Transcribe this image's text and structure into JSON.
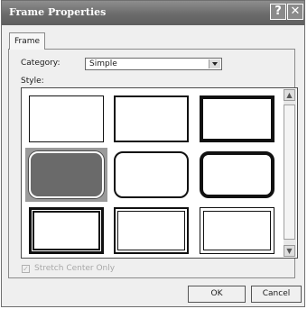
{
  "window": {
    "title": "Frame Properties",
    "help_glyph": "?",
    "close_glyph": "✕"
  },
  "tabs": [
    {
      "label": "Frame",
      "active": true
    }
  ],
  "category": {
    "label": "Category:",
    "value": "Simple"
  },
  "style": {
    "label": "Style:",
    "selected_index": 3,
    "items": [
      {
        "name": "thin-border-frame"
      },
      {
        "name": "medium-border-frame"
      },
      {
        "name": "thick-border-frame"
      },
      {
        "name": "rounded-gray-frame"
      },
      {
        "name": "rounded-medium-frame"
      },
      {
        "name": "rounded-thick-frame"
      },
      {
        "name": "double-line-frame"
      },
      {
        "name": "double-inset-frame"
      },
      {
        "name": "double-thin-frame"
      }
    ]
  },
  "scrollbar": {
    "up_glyph": "▲",
    "down_glyph": "▼"
  },
  "stretch_center": {
    "label": "Stretch Center Only",
    "checked": true,
    "enabled": false,
    "check_glyph": "✓"
  },
  "buttons": {
    "ok": "OK",
    "cancel": "Cancel"
  },
  "colors": {
    "selected_cell": "#9a9a9a",
    "frame_border": "#111111",
    "titlebar": "#6b6b6b"
  }
}
